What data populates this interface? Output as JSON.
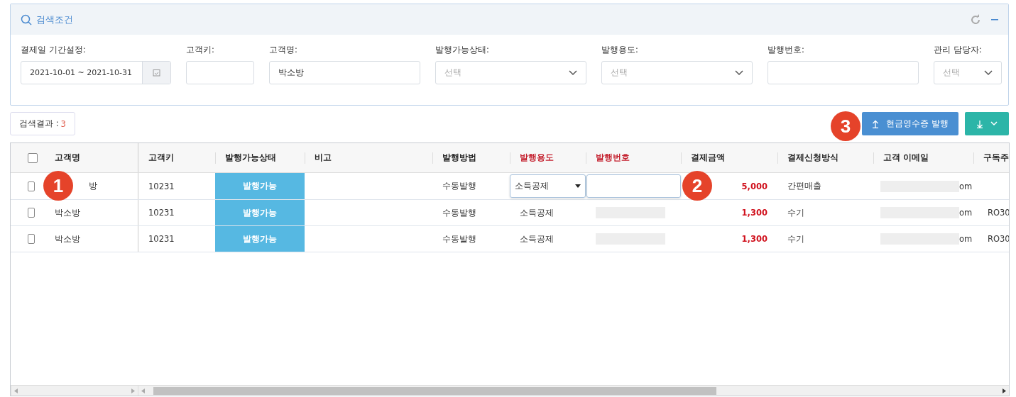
{
  "search_panel": {
    "title": "검색조건",
    "fields": [
      {
        "kind": "date",
        "label": "결제일 기간설정:",
        "value": "2021-10-01 ~ 2021-10-31"
      },
      {
        "kind": "text",
        "label": "고객키:"
      },
      {
        "kind": "text",
        "label": "고객명:",
        "value": "박소방"
      },
      {
        "kind": "select",
        "label": "발행가능상태:",
        "placeholder": "선택"
      },
      {
        "kind": "select",
        "label": "발행용도:",
        "placeholder": "선택"
      },
      {
        "kind": "text",
        "label": "발행번호:"
      },
      {
        "kind": "select",
        "label": "관리 담당자:",
        "placeholder": "선택"
      }
    ]
  },
  "result": {
    "label": "검색결과 :",
    "count": "3"
  },
  "issue_button": {
    "label": "현금영수증 발행"
  },
  "table": {
    "all_checked": false,
    "columns": [
      {
        "label": "고객명",
        "required": false
      },
      {
        "label": "고객키",
        "required": false
      },
      {
        "label": "발행가능상태",
        "required": false
      },
      {
        "label": "비고",
        "required": false
      },
      {
        "label": "발행방법",
        "required": false
      },
      {
        "label": "발행용도",
        "required": true
      },
      {
        "label": "발행번호",
        "required": true
      },
      {
        "label": "결제금액",
        "required": false
      },
      {
        "label": "결제신청방식",
        "required": false
      },
      {
        "label": "고객 이메일",
        "required": false
      },
      {
        "label": "구독주",
        "required": false
      }
    ],
    "rows": [
      {
        "checked": false,
        "name": "방",
        "key": "10231",
        "status": "발행가능",
        "method": "수동발행",
        "editing": true,
        "purpose": "소득공제",
        "amount": "5,000",
        "payment": "간편매출",
        "email_end": "om"
      },
      {
        "checked": false,
        "name": "박소방",
        "key": "10231",
        "status": "발행가능",
        "method": "수동발행",
        "editing": false,
        "purpose": "소득공제",
        "amount": "1,300",
        "payment": "수기",
        "email_end": "om",
        "subscription": "RO30"
      },
      {
        "checked": false,
        "name": "박소방",
        "key": "10231",
        "status": "발행가능",
        "method": "수동발행",
        "editing": false,
        "purpose": "소득공제",
        "amount": "1,300",
        "payment": "수기",
        "email_end": "om",
        "subscription": "RO30"
      }
    ]
  },
  "markers": [
    "1",
    "2",
    "3"
  ]
}
